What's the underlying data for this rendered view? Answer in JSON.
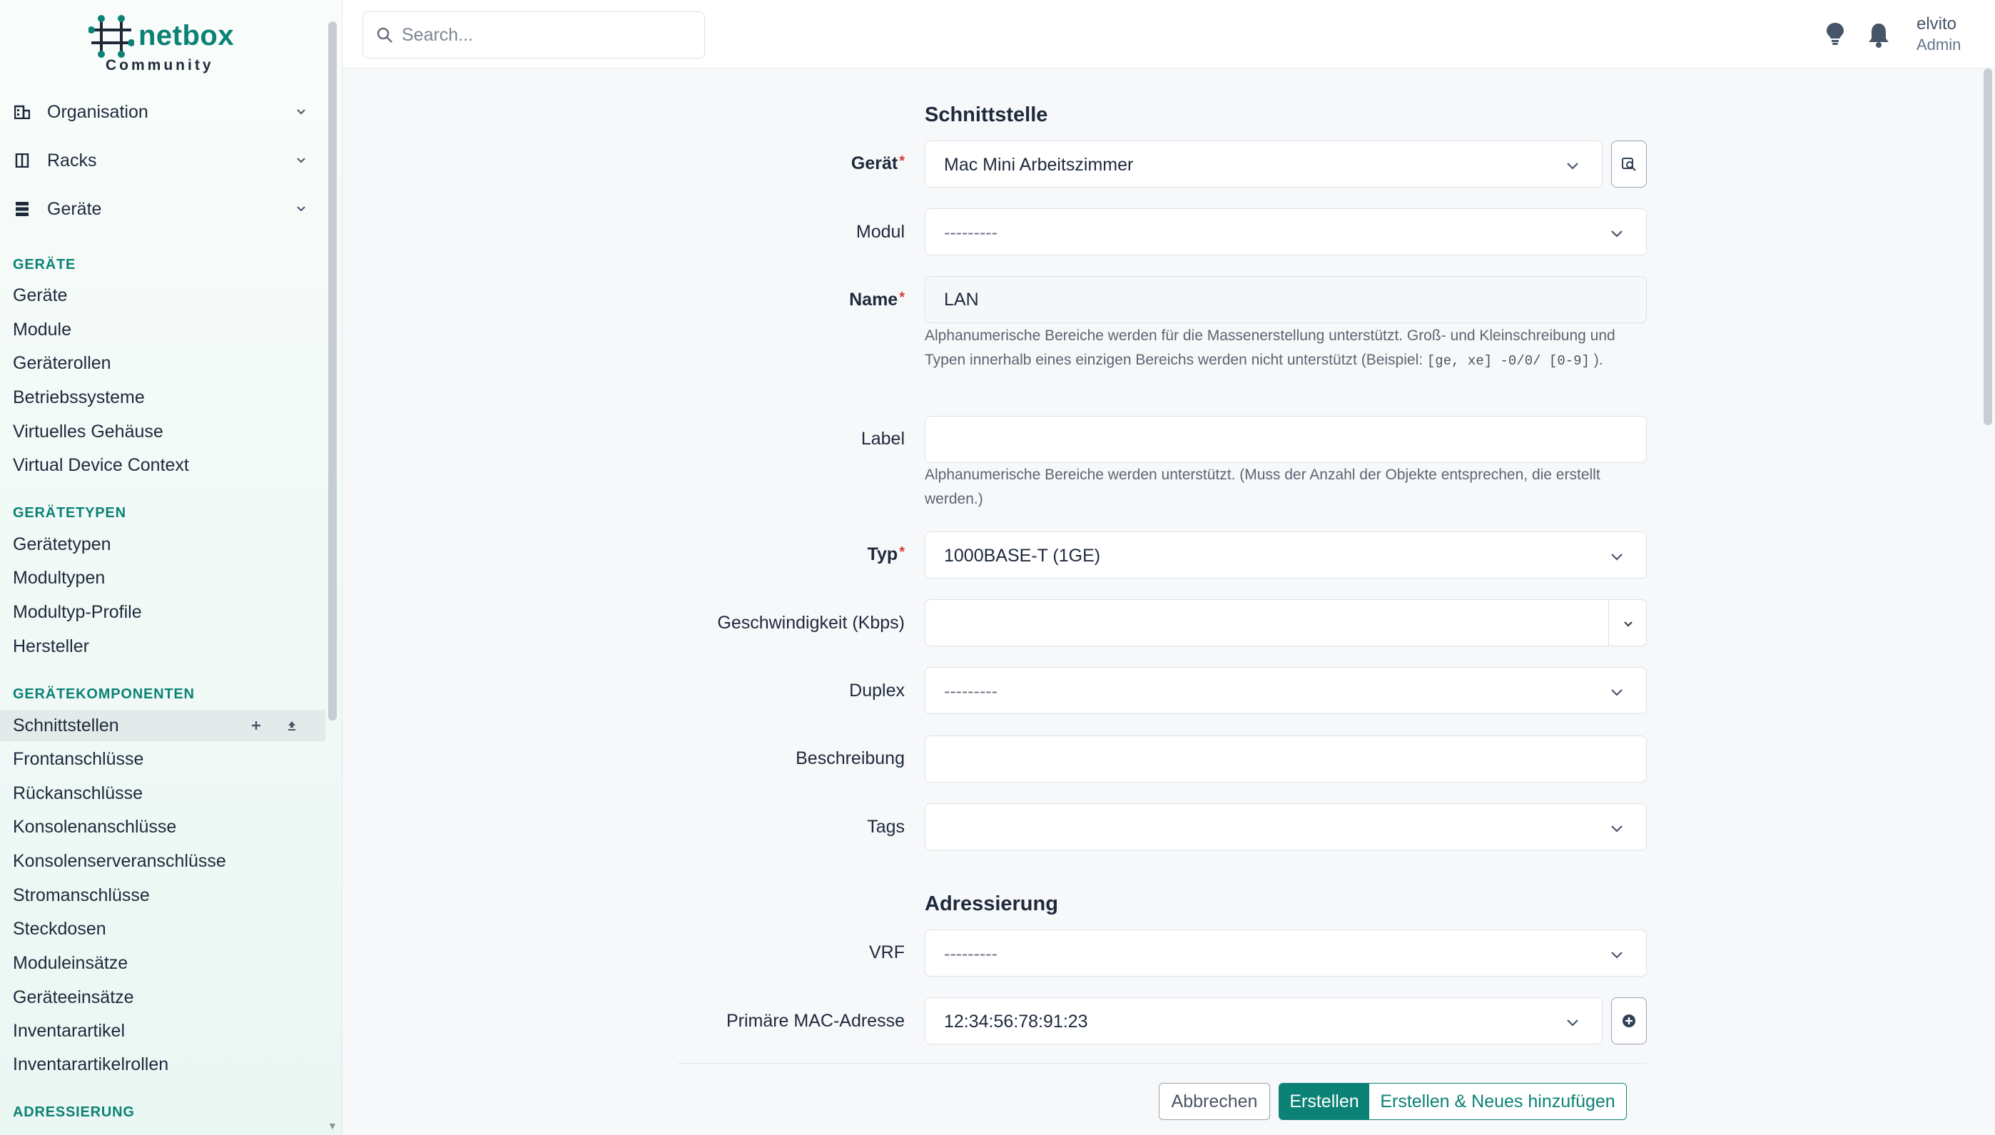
{
  "brand": {
    "name": "netbox",
    "edition": "Community"
  },
  "sidebar": {
    "groups": [
      {
        "label": "Organisation",
        "icon": "building-icon"
      },
      {
        "label": "Racks",
        "icon": "rack-icon"
      },
      {
        "label": "Geräte",
        "icon": "server-icon"
      }
    ],
    "sections": [
      {
        "title": "GERÄTE",
        "items": [
          "Geräte",
          "Module",
          "Geräterollen",
          "Betriebssysteme",
          "Virtuelles Gehäuse",
          "Virtual Device Context"
        ]
      },
      {
        "title": "GERÄTETYPEN",
        "items": [
          "Gerätetypen",
          "Modultypen",
          "Modultyp-Profile",
          "Hersteller"
        ]
      },
      {
        "title": "GERÄTEKOMPONENTEN",
        "items": [
          "Schnittstellen",
          "Frontanschlüsse",
          "Rückanschlüsse",
          "Konsolenanschlüsse",
          "Konsolenserveranschlüsse",
          "Stromanschlüsse",
          "Steckdosen",
          "Moduleinsätze",
          "Geräteeinsätze",
          "Inventarartikel",
          "Inventarartikelrollen"
        ]
      },
      {
        "title": "ADRESSIERUNG",
        "items": []
      }
    ],
    "active_item": "Schnittstellen",
    "active_actions": [
      "plus-icon",
      "upload-icon"
    ]
  },
  "topbar": {
    "search_placeholder": "Search...",
    "user": {
      "name": "elvito",
      "role": "Admin"
    },
    "icons": [
      "lightbulb-icon",
      "bell-icon"
    ]
  },
  "form": {
    "section_interface": "Schnittstelle",
    "section_addressing": "Adressierung",
    "device": {
      "label": "Gerät",
      "value": "Mac Mini Arbeitszimmer"
    },
    "module": {
      "label": "Modul",
      "value": "---------"
    },
    "name": {
      "label": "Name",
      "value": "LAN",
      "help_prefix": "Alphanumerische Bereiche werden für die Massenerstellung unterstützt. Groß- und Kleinschreibung und Typen innerhalb eines einzigen Bereichs werden nicht unterstützt (Beispiel: ",
      "help_code": "[ge, xe] -0/0/ [0-9]",
      "help_suffix": " )."
    },
    "label_field": {
      "label": "Label",
      "value": "",
      "help": "Alphanumerische Bereiche werden unterstützt. (Muss der Anzahl der Objekte entsprechen, die erstellt werden.)"
    },
    "type": {
      "label": "Typ",
      "value": "1000BASE-T (1GE)"
    },
    "speed": {
      "label": "Geschwindigkeit (Kbps)",
      "value": ""
    },
    "duplex": {
      "label": "Duplex",
      "value": "---------"
    },
    "description": {
      "label": "Beschreibung",
      "value": ""
    },
    "tags": {
      "label": "Tags",
      "value": ""
    },
    "vrf": {
      "label": "VRF",
      "value": "---------"
    },
    "mac": {
      "label": "Primäre MAC-Adresse",
      "value": "12:34:56:78:91:23"
    }
  },
  "buttons": {
    "cancel": "Abbrechen",
    "create": "Erstellen",
    "create_add": "Erstellen & Neues hinzufügen"
  },
  "colors": {
    "accent": "#0b8275",
    "required": "#d63939"
  }
}
